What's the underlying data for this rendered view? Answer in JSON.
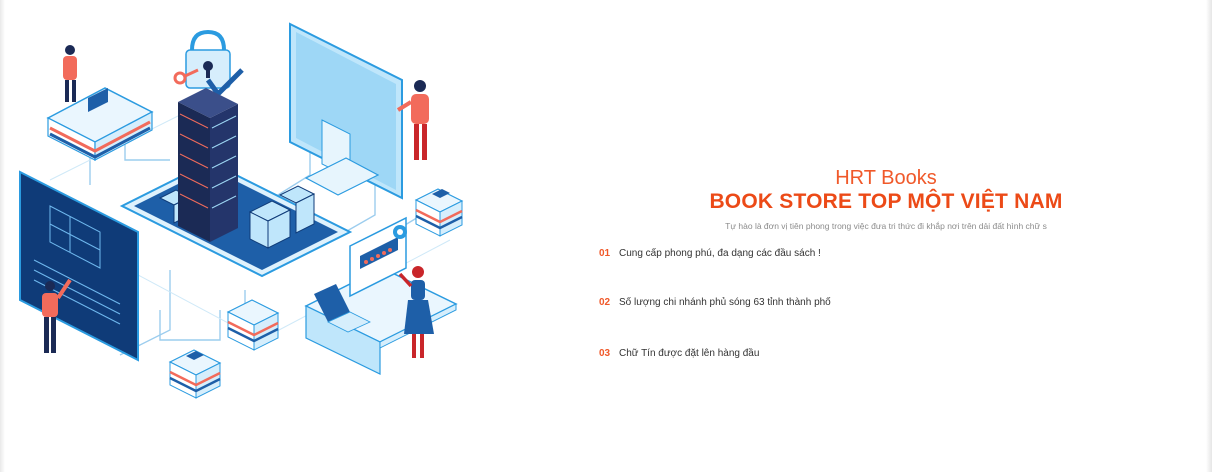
{
  "brand": {
    "name": "HRT Books",
    "headline": "BOOK STORE TOP MỘT VIỆT NAM",
    "subtitle": "Tự hào là đơn vị tiên phong trong việc đưa tri thức đi khắp nơi trên dải đất hình chữ s"
  },
  "features": [
    {
      "number": "01",
      "text": "Cung cấp phong phú, đa dạng các đầu sách !"
    },
    {
      "number": "02",
      "text": "Số lượng chi nhánh phủ sóng 63 tỉnh thành phố"
    },
    {
      "number": "03",
      "text": "Chữ Tín được đặt lên hàng đầu"
    }
  ],
  "colors": {
    "accent": "#f0592a",
    "illustration_blue": "#1e5fa8",
    "illustration_light": "#bfe6fb",
    "illustration_navy": "#1b2a55",
    "illustration_coral": "#f26b5b"
  },
  "illustration": {
    "icon": "isometric-smart-city-illustration"
  }
}
